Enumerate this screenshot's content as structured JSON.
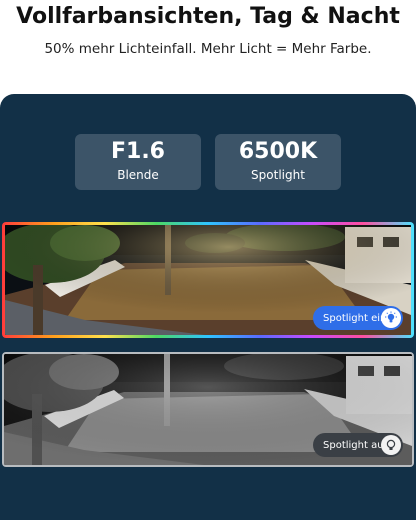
{
  "header": {
    "title": "Vollfarbansichten, Tag & Nacht",
    "subtitle": "50% mehr Lichteinfall. Mehr Licht = Mehr Farbe."
  },
  "stats": [
    {
      "value": "F1.6",
      "label": "Blende"
    },
    {
      "value": "6500K",
      "label": "Spotlight"
    }
  ],
  "images": {
    "color": {
      "badge": "Spotlight ein",
      "icon": "lightbulb-on-icon"
    },
    "bw": {
      "badge": "Spotlight aus",
      "icon": "lightbulb-off-icon"
    }
  },
  "colors": {
    "panel": "#123047",
    "stat_box": "#3c5468",
    "badge_on": "#2f6ee8",
    "badge_off": "#3a3f45"
  }
}
